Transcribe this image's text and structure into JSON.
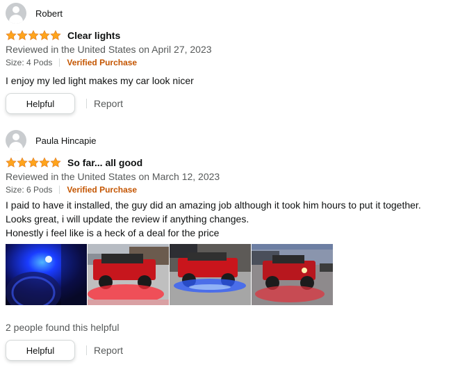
{
  "reviews": [
    {
      "reviewer": "Robert",
      "rating": 5,
      "title": "Clear lights",
      "date": "Reviewed in the United States on April 27, 2023",
      "size": "Size: 4 Pods",
      "verified": "Verified Purchase",
      "body": [
        "I enjoy my led light makes my car look nicer"
      ],
      "helpful_label": "Helpful",
      "report_label": "Report"
    },
    {
      "reviewer": "Paula Hincapie",
      "rating": 5,
      "title": "So far... all good",
      "date": "Reviewed in the United States on March 12, 2023",
      "size": "Size: 6 Pods",
      "verified": "Verified Purchase",
      "body": [
        "I paid to have it installed, the guy did an amazing job although it took him hours to put it together.",
        "Looks great, i will update the review if anything changes.",
        "Honestly i feel like is a heck of a deal for the price"
      ],
      "images": [
        "blue-light-wheel-photo",
        "red-jeep-red-lights-photo",
        "red-jeep-blue-lights-photo",
        "red-jeep-dusk-photo"
      ],
      "helpful_count": "2 people found this helpful",
      "helpful_label": "Helpful",
      "report_label": "Report"
    }
  ],
  "colors": {
    "star": "#ffa41c",
    "verified": "#c45500",
    "muted": "#565959"
  }
}
